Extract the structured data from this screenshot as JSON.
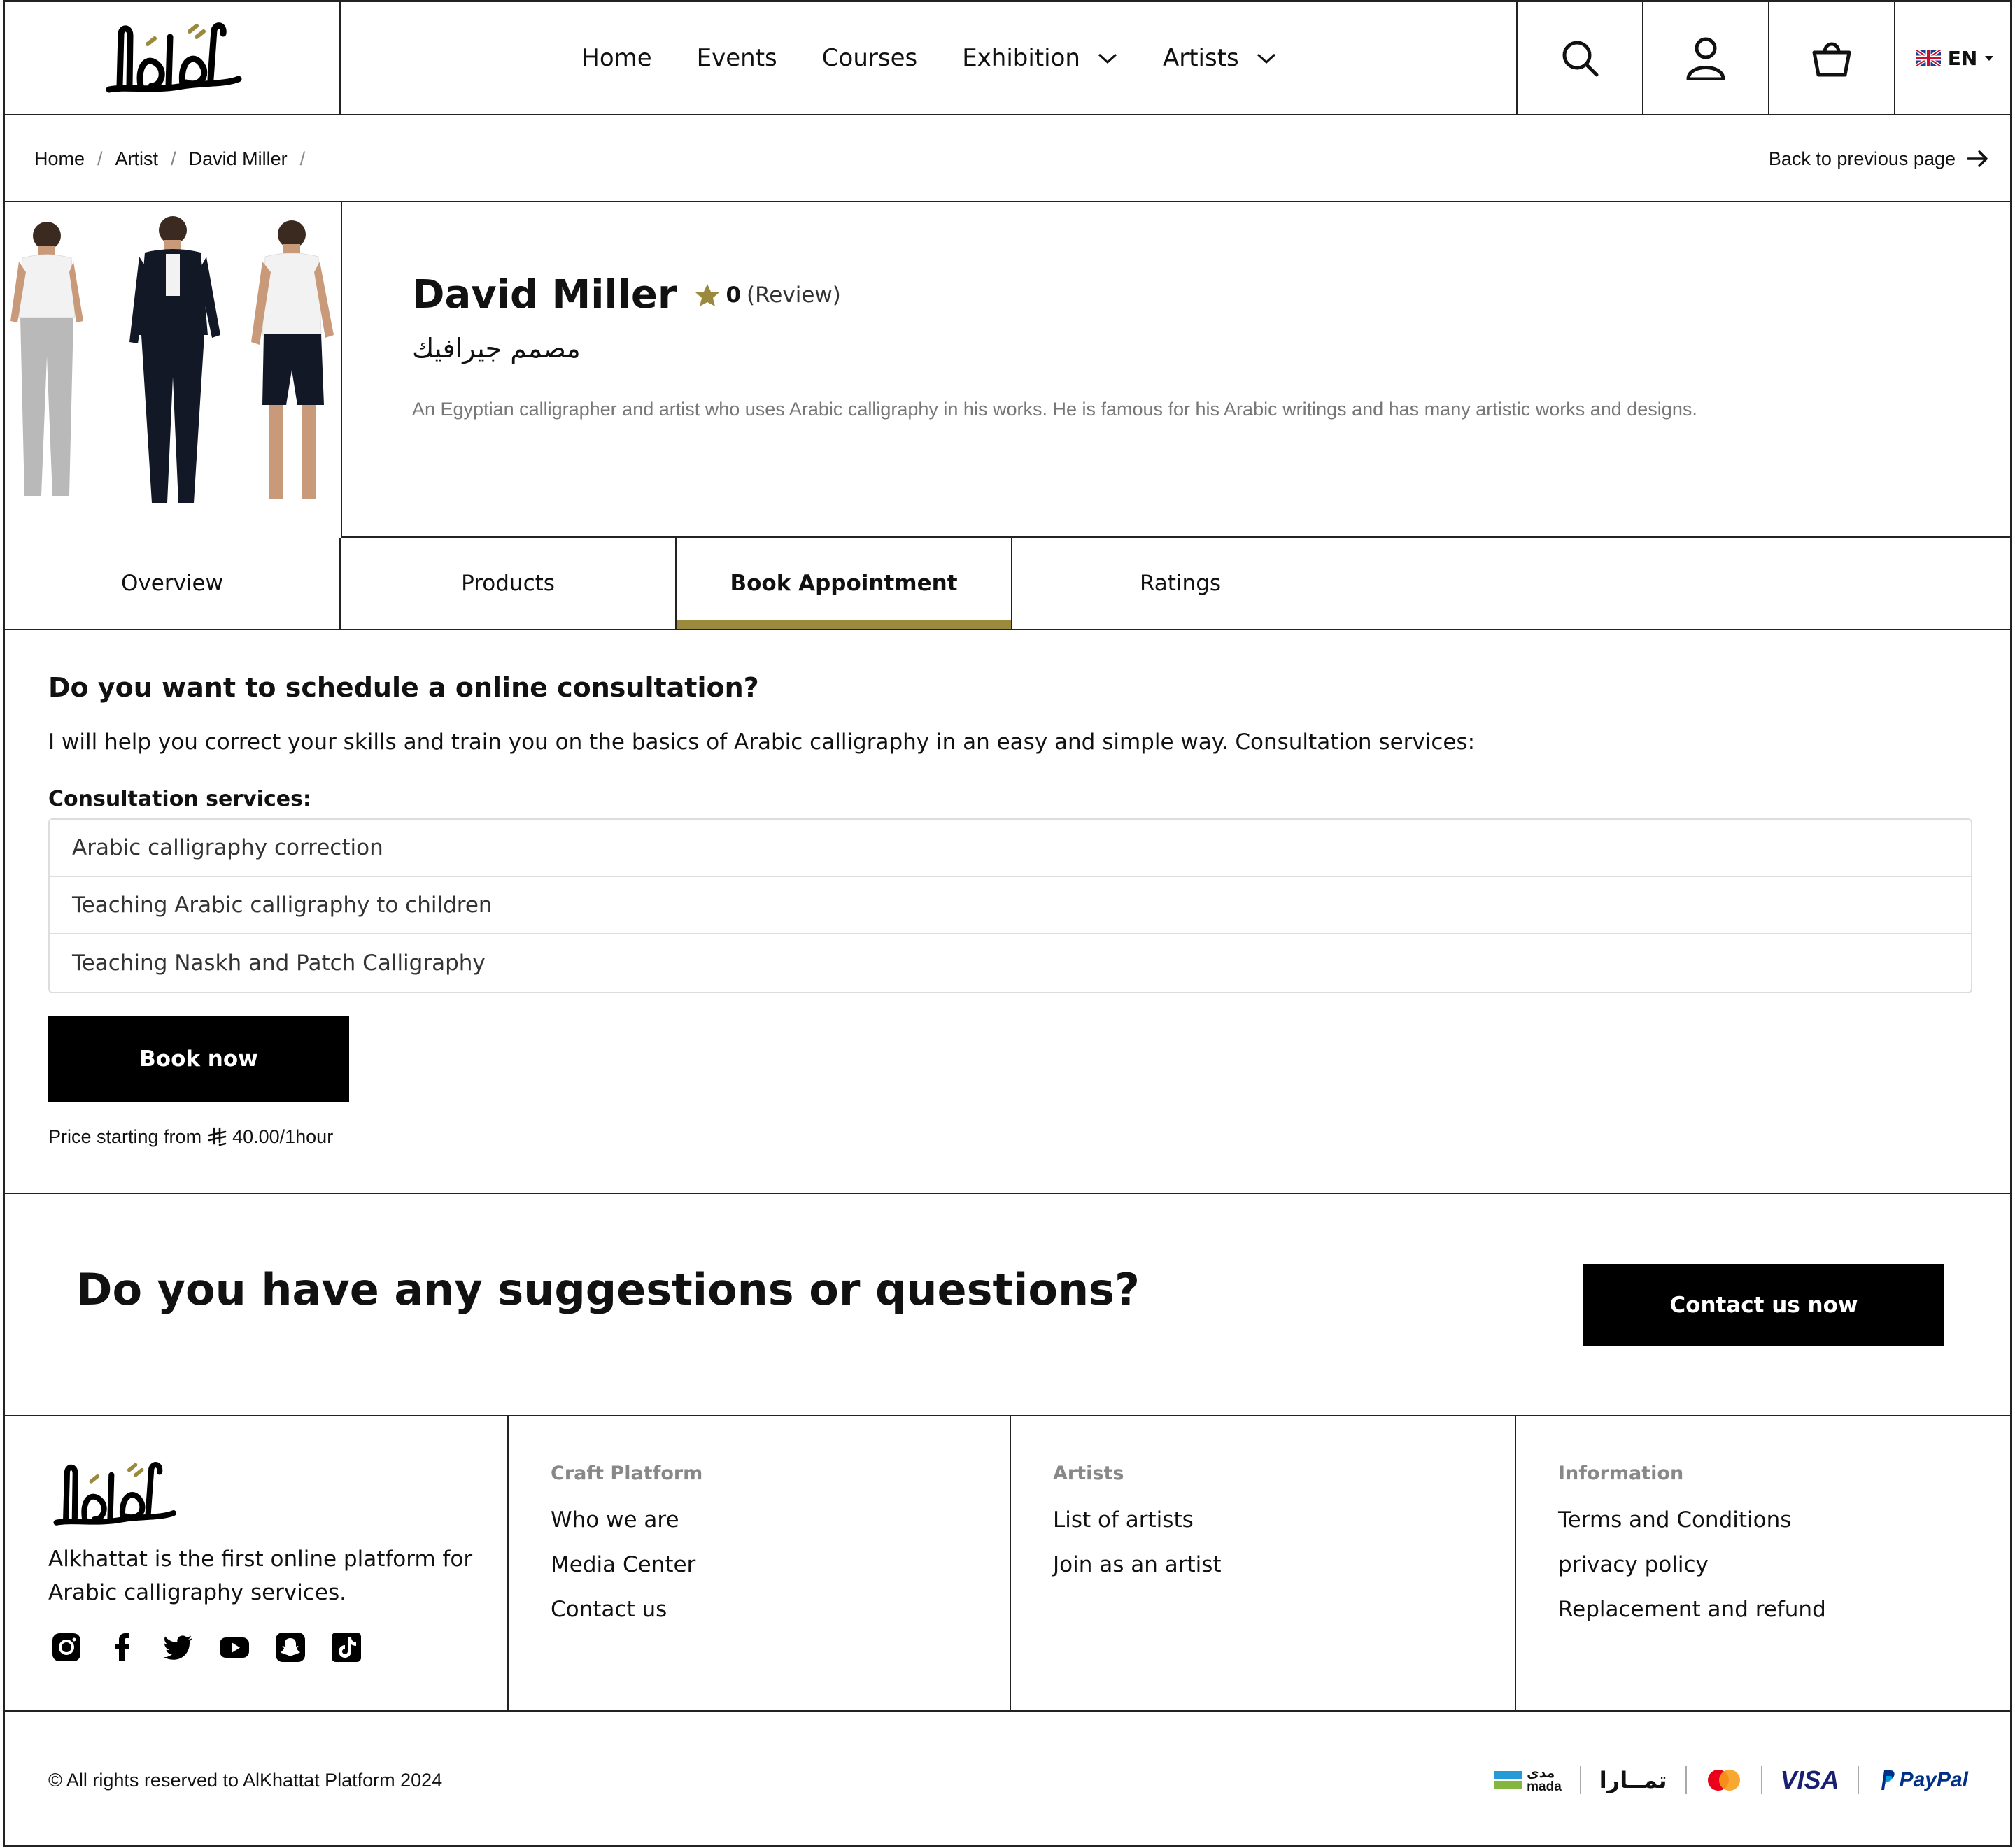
{
  "header": {
    "nav": [
      {
        "label": "Home",
        "dropdown": false
      },
      {
        "label": "Events",
        "dropdown": false
      },
      {
        "label": "Courses",
        "dropdown": false
      },
      {
        "label": "Exhibition",
        "dropdown": true
      },
      {
        "label": "Artists",
        "dropdown": true
      }
    ],
    "language": "EN"
  },
  "breadcrumb": {
    "items": [
      "Home",
      "Artist",
      "David Miller"
    ],
    "back_label": "Back to previous page"
  },
  "profile": {
    "name": "David Miller",
    "rating_value": "0",
    "rating_label": "(Review)",
    "title_ar": "مصمم جيرافيك",
    "description": "An Egyptian calligrapher and artist who uses Arabic calligraphy in his works. He is famous for his Arabic writings and has many artistic works and designs."
  },
  "tabs": [
    {
      "label": "Overview",
      "active": false
    },
    {
      "label": "Products",
      "active": false
    },
    {
      "label": "Book Appointment",
      "active": true
    },
    {
      "label": "Ratings",
      "active": false
    }
  ],
  "appointment": {
    "heading": "Do you want to schedule a online consultation?",
    "lead": "I will help you correct your skills and train you on the basics of Arabic calligraphy in an easy and simple way. Consultation services:",
    "services_label": "Consultation services:",
    "services": [
      "Arabic calligraphy correction",
      "Teaching Arabic calligraphy to children",
      "Teaching Naskh and Patch Calligraphy"
    ],
    "book_label": "Book now",
    "price_prefix": "Price starting from",
    "price_value": "40.00/1hour"
  },
  "suggest": {
    "heading": "Do you have any suggestions or questions?",
    "button": "Contact us now"
  },
  "footer": {
    "about": "Alkhattat is the first online platform for Arabic calligraphy services.",
    "social": [
      "instagram-icon",
      "facebook-icon",
      "twitter-icon",
      "youtube-icon",
      "snapchat-icon",
      "tiktok-icon"
    ],
    "columns": [
      {
        "heading": "Craft Platform",
        "links": [
          "Who we are",
          "Media Center",
          "Contact us"
        ]
      },
      {
        "heading": "Artists",
        "links": [
          "List of artists",
          "Join as an artist"
        ]
      },
      {
        "heading": "Information",
        "links": [
          "Terms and Conditions",
          "privacy policy",
          "Replacement and refund"
        ]
      }
    ],
    "copyright": "© All rights reserved to AlKhattat Platform 2024",
    "payments": {
      "mada_ar": "مدى",
      "mada_en": "mada",
      "tamara": "تمــارا",
      "visa": "VISA",
      "paypal": "PayPal"
    }
  },
  "colors": {
    "accent": "#9b8a3e",
    "button": "#000000",
    "border": "#222222"
  }
}
